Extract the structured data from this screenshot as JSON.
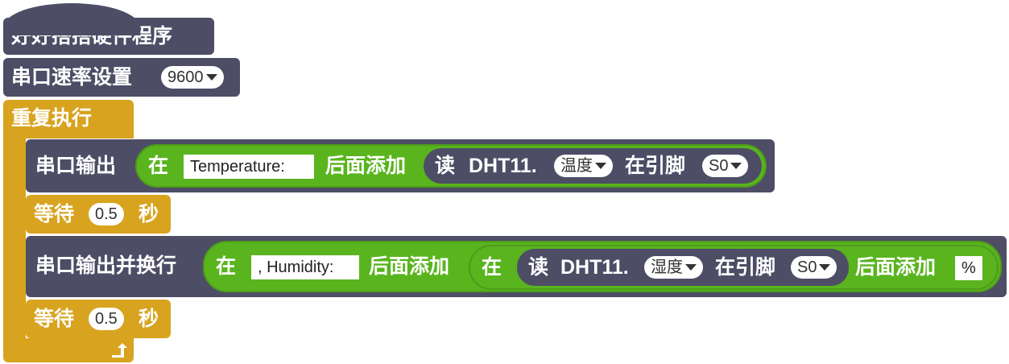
{
  "hat": {
    "label": "好好搭搭硬件程序"
  },
  "serial_setup": {
    "label": "串口速率设置",
    "baud": "9600"
  },
  "loop": {
    "label": "重复执行"
  },
  "serial_print": {
    "label": "串口输出",
    "join_prefix": "在",
    "text": "Temperature:",
    "join_suffix": "后面添加",
    "sensor": {
      "read": "读",
      "model": "DHT11.",
      "measure": "温度",
      "pin_label": "在引脚",
      "pin": "S0"
    }
  },
  "wait1": {
    "label": "等待",
    "value": "0.5",
    "unit": "秒"
  },
  "serial_println": {
    "label": "串口输出并换行",
    "join_prefix": "在",
    "text": ", Humidity:",
    "join_suffix": "后面添加",
    "inner_join": {
      "prefix": "在",
      "sensor": {
        "read": "读",
        "model": "DHT11.",
        "measure": "湿度",
        "pin_label": "在引脚",
        "pin": "S0"
      },
      "suffix": "后面添加",
      "text": "%"
    }
  },
  "wait2": {
    "label": "等待",
    "value": "0.5",
    "unit": "秒"
  },
  "loop_end": {
    "icon": "loop-arrow-icon"
  },
  "colors": {
    "dark": "#4d4d66",
    "gold": "#d8a31f",
    "green": "#59b41e"
  }
}
